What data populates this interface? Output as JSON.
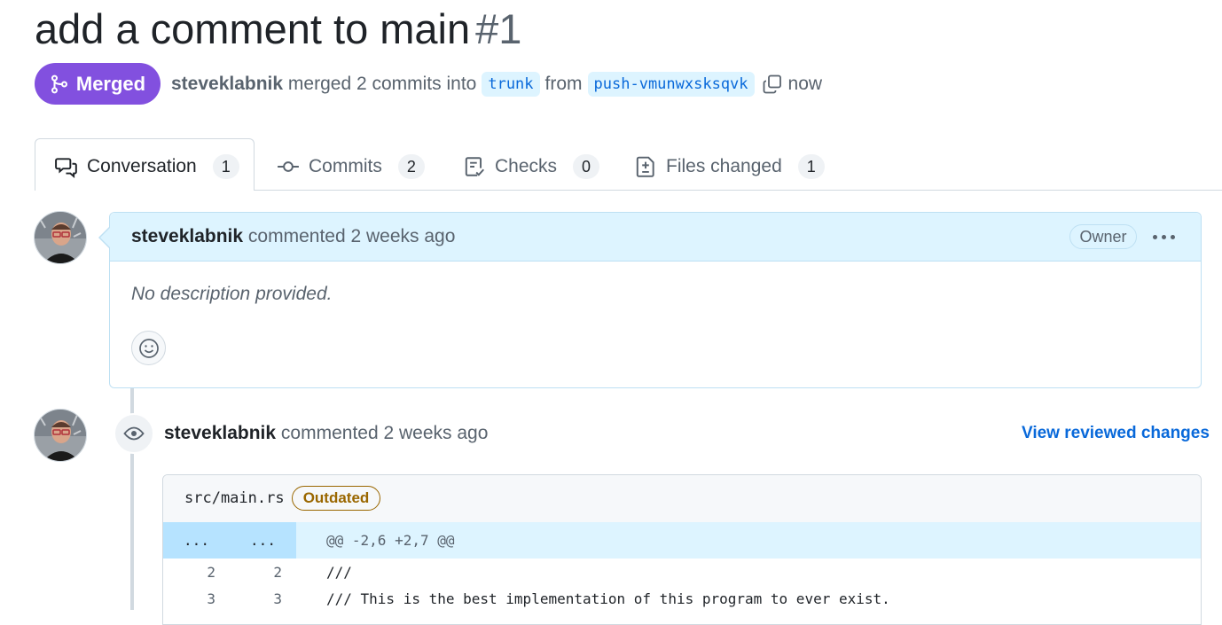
{
  "pr": {
    "title": "add a comment to main",
    "number": "#1",
    "state_label": "Merged",
    "merged_by": "steveklabnik",
    "merged_text": "merged 2 commits into",
    "base_branch": "trunk",
    "from_text": "from",
    "head_branch": "push-vmunwxsksqvk",
    "time": "now"
  },
  "tabs": [
    {
      "label": "Conversation",
      "count": "1",
      "icon": "comment-discussion-icon"
    },
    {
      "label": "Commits",
      "count": "2",
      "icon": "git-commit-icon"
    },
    {
      "label": "Checks",
      "count": "0",
      "icon": "checklist-icon"
    },
    {
      "label": "Files changed",
      "count": "1",
      "icon": "file-diff-icon"
    }
  ],
  "comment": {
    "author": "steveklabnik",
    "action": "commented 2 weeks ago",
    "badge": "Owner",
    "body": "No description provided."
  },
  "review": {
    "author": "steveklabnik",
    "action": "commented 2 weeks ago",
    "link": "View reviewed changes",
    "file": "src/main.rs",
    "status": "Outdated",
    "hunk_left": "...",
    "hunk_right": "...",
    "hunk_header": "@@ -2,6 +2,7 @@",
    "lines": [
      {
        "old": "2",
        "new": "2",
        "text": "///"
      },
      {
        "old": "3",
        "new": "3",
        "text": "/// This is the best implementation of this program to ever exist."
      }
    ]
  },
  "colors": {
    "merged": "#8250df",
    "link": "#0969da",
    "comment_header_bg": "#ddf4ff",
    "outdated": "#9a6700"
  }
}
